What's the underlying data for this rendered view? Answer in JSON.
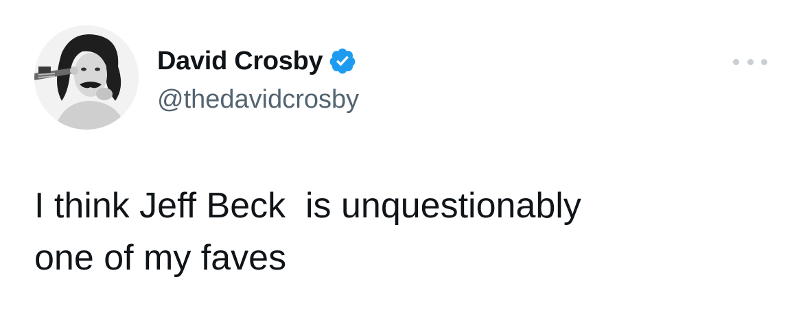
{
  "author": {
    "display_name": "David Crosby",
    "handle": "@thedavidcrosby",
    "verified": true,
    "verified_color": "#1d9bf0"
  },
  "menu": {
    "icon": "more-horizontal-icon"
  },
  "tweet": {
    "text": "I think Jeff Beck  is unquestionably\none of my faves"
  },
  "colors": {
    "text": "#0f1419",
    "secondary_text": "#536471",
    "menu_dots": "#c9ced3"
  }
}
